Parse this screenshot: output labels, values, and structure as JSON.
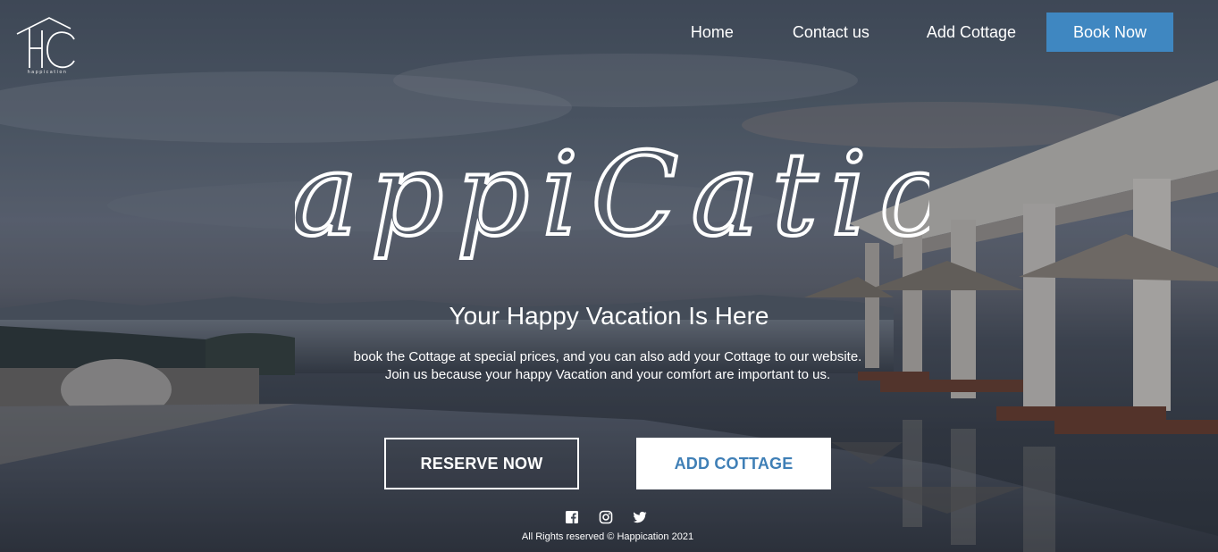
{
  "brand": {
    "logo_text": "happication",
    "title": "HappiCation"
  },
  "nav": {
    "items": [
      {
        "label": "Home"
      },
      {
        "label": "Contact us"
      },
      {
        "label": "Add Cottage"
      }
    ],
    "cta_label": "Book Now"
  },
  "hero": {
    "tagline": "Your Happy Vacation Is Here",
    "description_line1": "book the Cottage at special prices, and you can also add your Cottage to our website.",
    "description_line2": "Join us because your happy Vacation and your comfort are important to us.",
    "reserve_label": "RESERVE NOW",
    "add_cottage_label": "ADD COTTAGE"
  },
  "footer": {
    "social": [
      {
        "icon": "facebook-icon"
      },
      {
        "icon": "instagram-icon"
      },
      {
        "icon": "twitter-icon"
      }
    ],
    "copyright": "All Rights reserved © Happication 2021"
  },
  "colors": {
    "accent": "#3f87c1",
    "accent_text": "#3f7fb6",
    "text": "#ffffff"
  }
}
